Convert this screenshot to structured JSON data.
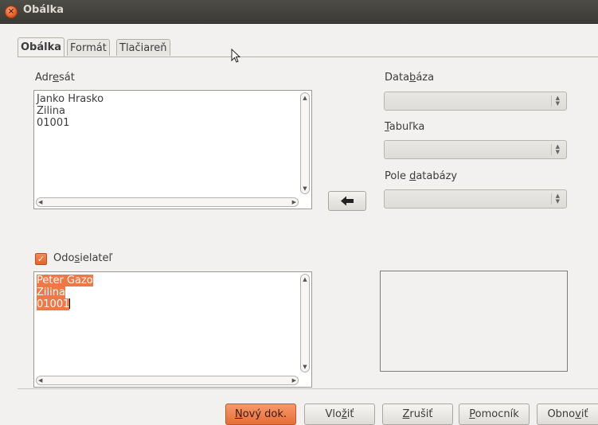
{
  "window": {
    "title": "Obálka"
  },
  "tabs": [
    {
      "label": "Obálka",
      "active": true
    },
    {
      "label": "Formát",
      "active": false
    },
    {
      "label": "Tlačiareň",
      "active": false
    }
  ],
  "addressee": {
    "label_pre": "Adr",
    "label_mn": "e",
    "label_post": "sát",
    "lines": [
      "Janko Hrasko",
      "Zilina",
      "01001"
    ]
  },
  "database": {
    "label_pre": "Data",
    "label_mn": "b",
    "label_post": "áza",
    "value": ""
  },
  "table": {
    "label_mn": "T",
    "label_post": "abuľka",
    "value": ""
  },
  "db_field": {
    "label_pre": "Pole ",
    "label_mn": "d",
    "label_post": "atabázy",
    "value": ""
  },
  "sender": {
    "checked": true,
    "label_pre": "Odo",
    "label_mn": "s",
    "label_post": "ielateľ",
    "lines": [
      "Peter Gazo",
      "Zilina",
      "01001"
    ]
  },
  "buttons": {
    "new_doc": {
      "mn": "N",
      "rest": "ový dok."
    },
    "insert": {
      "pre": "Vlo",
      "mn": "ž",
      "rest": "iť"
    },
    "cancel": {
      "mn": "Z",
      "rest": "rušiť"
    },
    "help": {
      "mn": "P",
      "rest": "omocník"
    },
    "reset": {
      "pre": "Obno",
      "mn": "v",
      "rest": "iť"
    }
  },
  "colors": {
    "accent": "#e76d36",
    "selection": "#f07746",
    "titlebar": "#3b3a36"
  },
  "icons": {
    "close": "close-icon",
    "insert_arrow": "arrow-left-icon",
    "checkbox": "checkmark-icon",
    "spin": "spin-updown-icon",
    "cursor": "mouse-pointer-icon"
  }
}
